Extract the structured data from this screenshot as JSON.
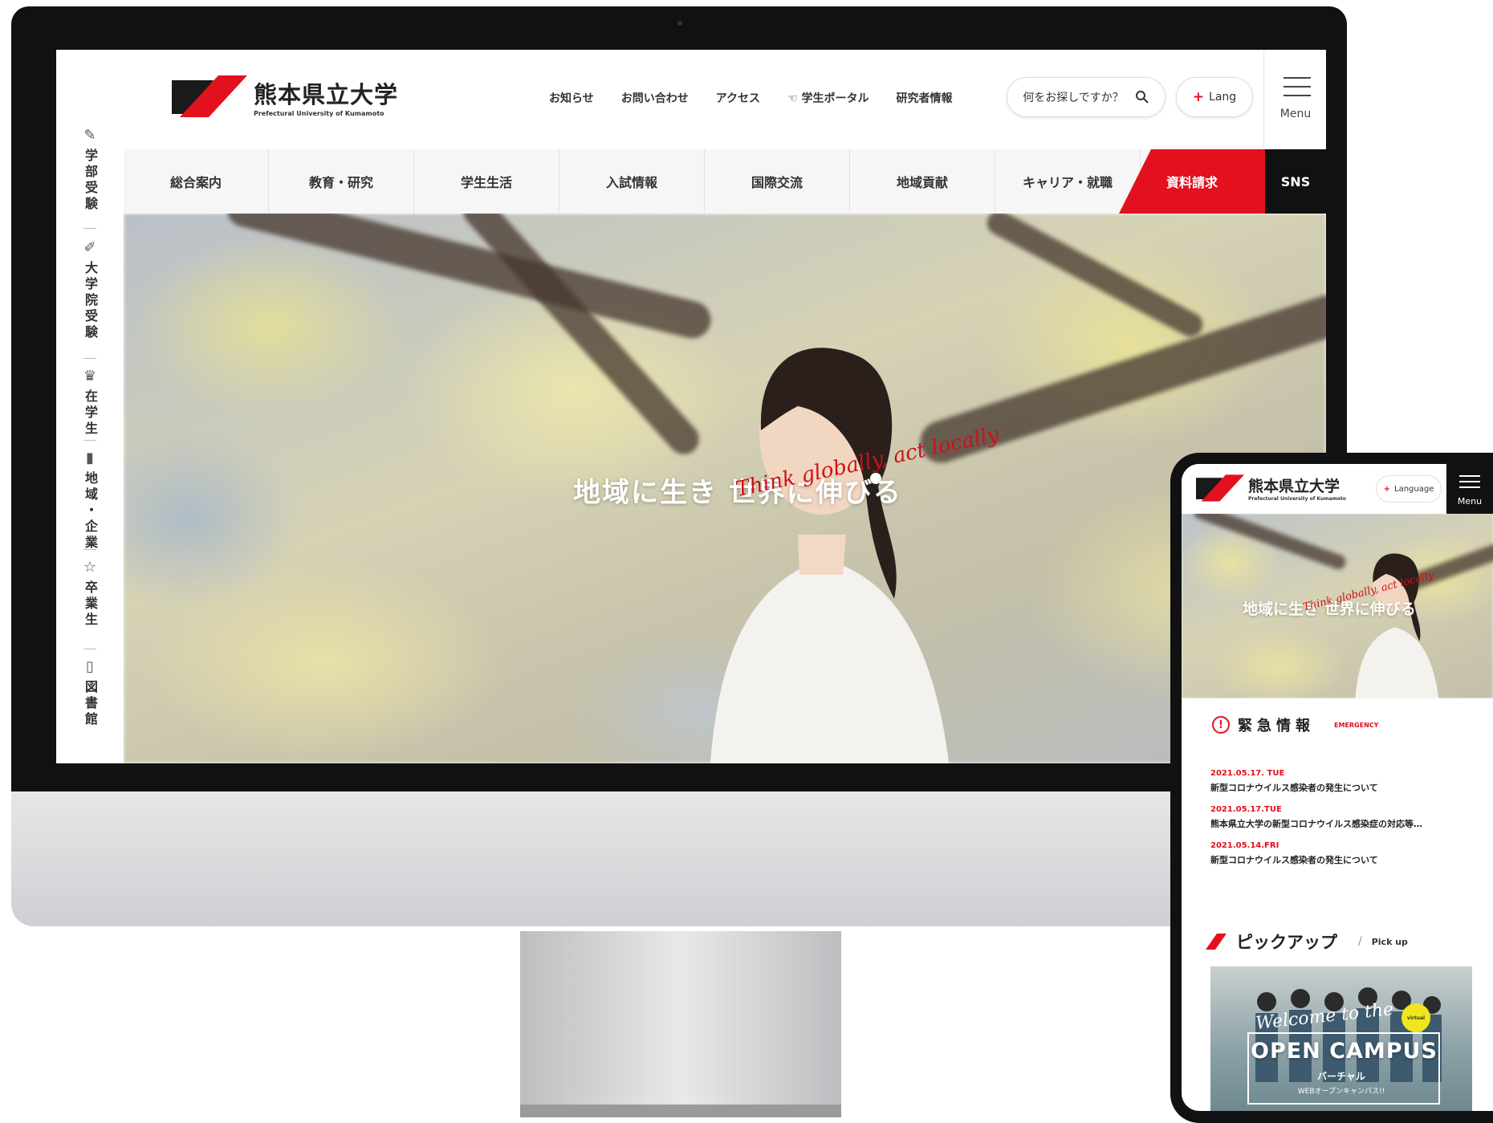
{
  "desktop": {
    "logo": {
      "name_jp": "熊本県立大学",
      "name_en": "Prefectural University of Kumamoto"
    },
    "top_nav": [
      "お知らせ",
      "お問い合わせ",
      "アクセス",
      "学生ポータル",
      "研究者情報"
    ],
    "search": {
      "placeholder": "何をお探しですか？"
    },
    "lang": {
      "label": "Lang"
    },
    "menu": {
      "label": "Menu"
    },
    "global_nav": [
      "総合案内",
      "教育・研究",
      "学生生活",
      "入試情報",
      "国際交流",
      "地域貢献",
      "キャリア・就職"
    ],
    "request_label": "資料請求",
    "sns_label": "SNS",
    "side_links": [
      "学部受験",
      "大学院受験",
      "在学生",
      "地域・企業",
      "卒業生",
      "図書館"
    ],
    "hero": {
      "catch": "地域に生き 世界に伸びる",
      "script": "Think globally, act locally"
    }
  },
  "mobile": {
    "logo": {
      "name_jp": "熊本県立大学",
      "name_en": "Prefectural University of Kumamoto"
    },
    "lang_label": "Language",
    "menu_label": "Menu",
    "hero": {
      "catch": "地域に生き 世界に伸びる",
      "script": "Think globally, act locally"
    },
    "emergency": {
      "title": "緊急情報",
      "en": "EMERGENCY",
      "items": [
        {
          "date": "2021.05.17. TUE",
          "title": "新型コロナウイルス感染者の発生について"
        },
        {
          "date": "2021.05.17.TUE",
          "title": "熊本県立大学の新型コロナウイルス感染症の対応等…"
        },
        {
          "date": "2021.05.14.FRI",
          "title": "新型コロナウイルス感染者の発生について"
        }
      ]
    },
    "pickup": {
      "title": "ピックアップ",
      "en": "Pick up"
    },
    "banner": {
      "welcome": "Welcome to the",
      "title": "OPEN CAMPUS",
      "sub1": "バーチャル",
      "sub2": "WEBオープンキャンパス!!",
      "badge": "virtual"
    }
  },
  "colors": {
    "accent": "#e3101e",
    "dark": "#111111",
    "nav_bg": "#f6f6f6"
  }
}
